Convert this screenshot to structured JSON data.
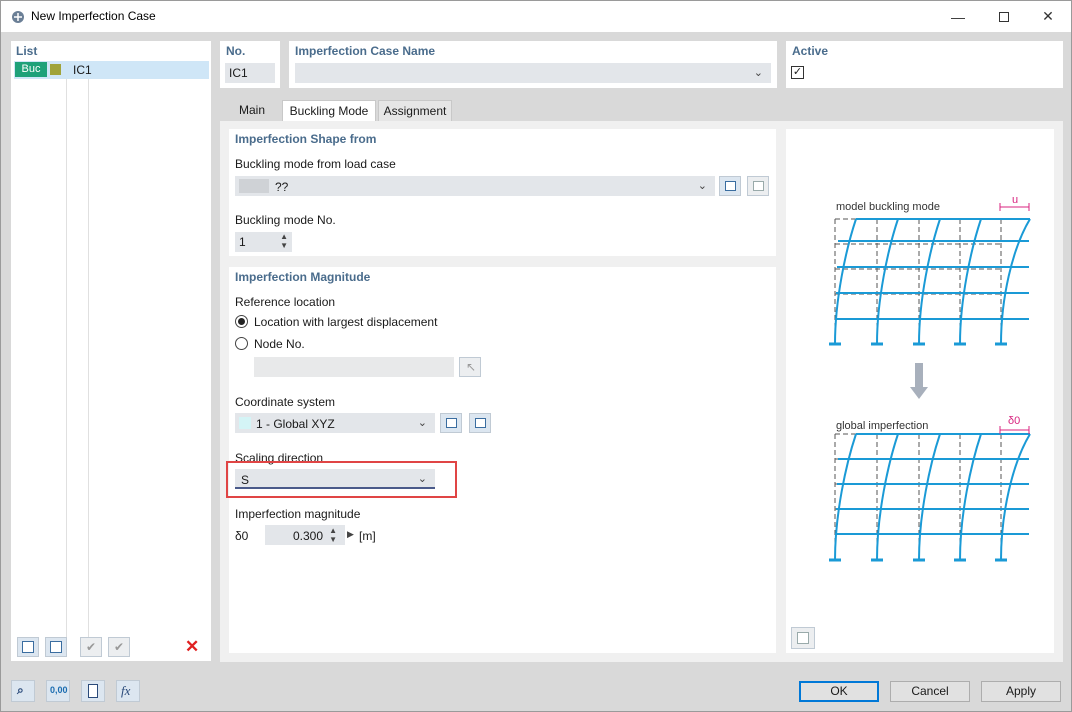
{
  "window": {
    "title": "New Imperfection Case",
    "minimize_icon": "minimize-icon",
    "maximize_icon": "maximize-icon",
    "close_icon": "close-icon"
  },
  "list": {
    "header": "List",
    "items": [
      {
        "tag": "Buc",
        "name": "IC1"
      }
    ]
  },
  "top": {
    "no_label": "No.",
    "no_value": "IC1",
    "name_label": "Imperfection Case Name",
    "name_value": "",
    "active_label": "Active",
    "active_checked": true
  },
  "tabs": [
    {
      "label": "Main"
    },
    {
      "label": "Buckling Mode"
    },
    {
      "label": "Assignment"
    }
  ],
  "shape": {
    "header": "Imperfection Shape from",
    "load_case_label": "Buckling mode from load case",
    "load_case_value": "??",
    "mode_no_label": "Buckling mode No.",
    "mode_no_value": "1"
  },
  "magnitude": {
    "header": "Imperfection Magnitude",
    "reference_label": "Reference location",
    "opt_largest": "Location with largest displacement",
    "opt_node": "Node No.",
    "coord_label": "Coordinate system",
    "coord_value": "1 - Global XYZ",
    "scaling_label": "Scaling direction",
    "scaling_value": "S",
    "imp_label": "Imperfection magnitude",
    "imp_symbol": "δ0",
    "imp_value": "0.300",
    "imp_unit": "[m]"
  },
  "diagram": {
    "top_caption": "model buckling mode",
    "top_marker": "u",
    "bottom_caption": "global imperfection",
    "bottom_marker": "δ0"
  },
  "buttons": {
    "ok": "OK",
    "cancel": "Cancel",
    "apply": "Apply"
  },
  "colors": {
    "accent": "#0078d7",
    "frame": "#1a9ad6",
    "highlight": "#e04545",
    "header": "#4a6c8c"
  }
}
